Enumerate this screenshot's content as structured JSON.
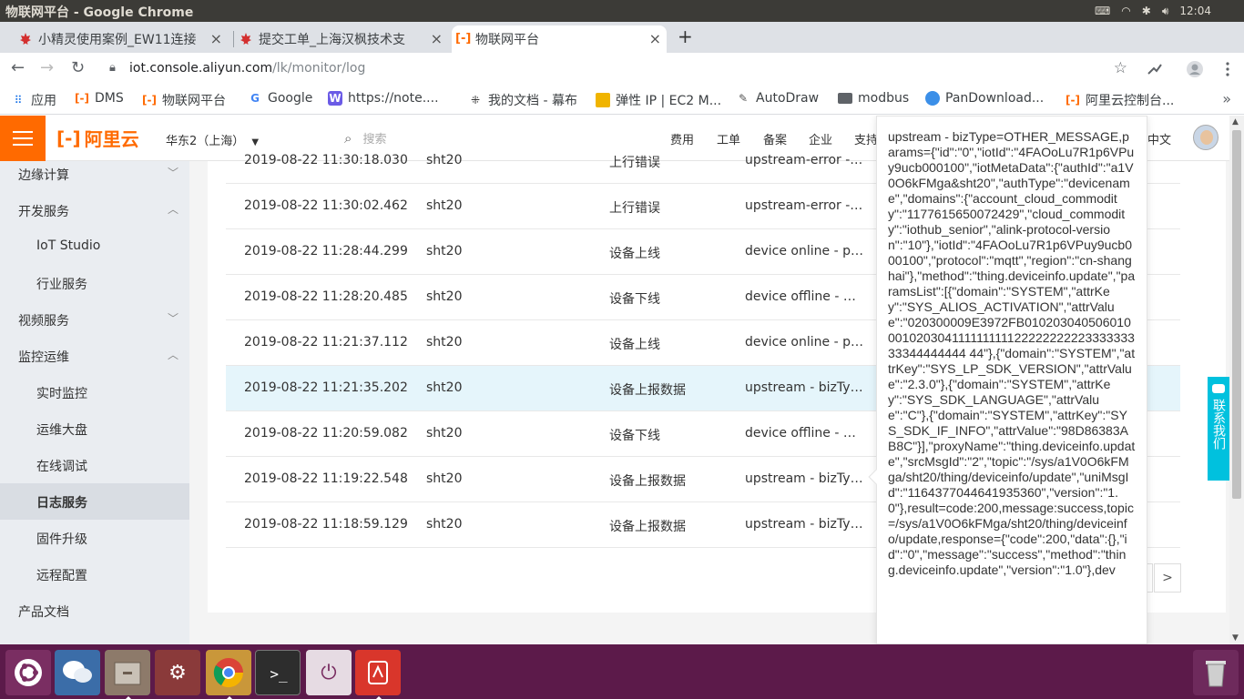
{
  "system": {
    "window_title": "物联网平台 - Google Chrome",
    "clock": "12:04"
  },
  "tabs": [
    {
      "label": "小精灵使用案例_EW11连接",
      "close": "×"
    },
    {
      "label": "提交工单_上海汉枫技术支",
      "close": "×"
    },
    {
      "label": "物联网平台",
      "close": "×"
    }
  ],
  "toolbar": {
    "new_tab": "+",
    "back": "←",
    "forward": "→",
    "reload": "↻",
    "url_host": "iot.console.aliyun.com",
    "url_path": "/lk/monitor/log",
    "star": "☆"
  },
  "bookmarks": [
    {
      "label": "应用",
      "icon": "apps-icon"
    },
    {
      "label": "DMS",
      "icon": "aliyun-icon"
    },
    {
      "label": "物联网平台",
      "icon": "aliyun-icon"
    },
    {
      "label": "Google",
      "icon": "google-icon"
    },
    {
      "label": "https://note....",
      "icon": "note-icon"
    },
    {
      "label": "我的文档 - 幕布",
      "icon": "mubu-icon"
    },
    {
      "label": "弹性 IP | EC2 M...",
      "icon": "aws-icon"
    },
    {
      "label": "AutoDraw",
      "icon": "autodraw-icon"
    },
    {
      "label": "modbus",
      "icon": "folder-icon"
    },
    {
      "label": "PanDownload...",
      "icon": "cloud-icon"
    },
    {
      "label": "阿里云控制台...",
      "icon": "aliyun-icon"
    }
  ],
  "header": {
    "logo": "阿里云",
    "region": "华东2（上海）",
    "search_placeholder": "搜索",
    "links": [
      "费用",
      "工单",
      "备案",
      "企业",
      "支持"
    ],
    "language": "中文"
  },
  "sidebar": {
    "items": [
      {
        "label": "边缘计算",
        "chevron": "down",
        "level": 1
      },
      {
        "label": "开发服务",
        "chevron": "up",
        "level": 1
      },
      {
        "label": "IoT Studio",
        "level": 2
      },
      {
        "label": "行业服务",
        "level": 2
      },
      {
        "label": "视频服务",
        "chevron": "down",
        "level": 1
      },
      {
        "label": "监控运维",
        "chevron": "up",
        "level": 1
      },
      {
        "label": "实时监控",
        "level": 2
      },
      {
        "label": "运维大盘",
        "level": 2
      },
      {
        "label": "在线调试",
        "level": 2
      },
      {
        "label": "日志服务",
        "level": 2,
        "active": true
      },
      {
        "label": "固件升级",
        "level": 2
      },
      {
        "label": "远程配置",
        "level": 2
      },
      {
        "label": "产品文档",
        "level": 1
      }
    ]
  },
  "logs": {
    "rows": [
      {
        "time": "2019-08-22 11:30:18.030",
        "device": "sht20",
        "type": "上行错误",
        "content": "upstream-error - ..."
      },
      {
        "time": "2019-08-22 11:30:02.462",
        "device": "sht20",
        "type": "上行错误",
        "content": "upstream-error - ..."
      },
      {
        "time": "2019-08-22 11:28:44.299",
        "device": "sht20",
        "type": "设备上线",
        "content": "device online - pa..."
      },
      {
        "time": "2019-08-22 11:28:20.485",
        "device": "sht20",
        "type": "设备下线",
        "content": "device offline - pa..."
      },
      {
        "time": "2019-08-22 11:21:37.112",
        "device": "sht20",
        "type": "设备上线",
        "content": "device online - pa..."
      },
      {
        "time": "2019-08-22 11:21:35.202",
        "device": "sht20",
        "type": "设备上报数据",
        "content": "upstream - bizTyp..."
      },
      {
        "time": "2019-08-22 11:20:59.082",
        "device": "sht20",
        "type": "设备下线",
        "content": "device offline - pa..."
      },
      {
        "time": "2019-08-22 11:19:22.548",
        "device": "sht20",
        "type": "设备上报数据",
        "content": "upstream - bizTyp..."
      },
      {
        "time": "2019-08-22 11:18:59.129",
        "device": "sht20",
        "type": "设备上报数据",
        "content": "upstream - bizTyp..."
      }
    ],
    "pagination": {
      "prev": "<",
      "next": ">"
    }
  },
  "popover": {
    "text": "upstream - bizType=OTHER_MESSAGE,params={\"id\":\"0\",\"iotId\":\"4FAOoLu7R1p6VPuy9ucb000100\",\"iotMetaData\":{\"authId\":\"a1V0O6kFMga&sht20\",\"authType\":\"devicename\",\"domains\":{\"account_cloud_commodity\":\"1177615650072429\",\"cloud_commodity\":\"iothub_senior\",\"alink-protocol-version\":\"10\"},\"iotId\":\"4FAOoLu7R1p6VPuy9ucb000100\",\"protocol\":\"mqtt\",\"region\":\"cn-shanghai\"},\"method\":\"thing.deviceinfo.update\",\"paramsList\":[{\"domain\":\"SYSTEM\",\"attrKey\":\"SYS_ALIOS_ACTIVATION\",\"attrValue\":\"020300009E3972FB01020304050601000102030411111111112222222222333333333344444444 44\"},{\"domain\":\"SYSTEM\",\"attrKey\":\"SYS_LP_SDK_VERSION\",\"attrValue\":\"2.3.0\"},{\"domain\":\"SYSTEM\",\"attrKey\":\"SYS_SDK_LANGUAGE\",\"attrValue\":\"C\"},{\"domain\":\"SYSTEM\",\"attrKey\":\"SYS_SDK_IF_INFO\",\"attrValue\":\"98D86383AB8C\"}],\"proxyName\":\"thing.deviceinfo.update\",\"srcMsgId\":\"2\",\"topic\":\"/sys/a1V0O6kFMga/sht20/thing/deviceinfo/update\",\"uniMsgId\":\"1164377044641935360\",\"version\":\"1.0\"},result=code:200,message:success,topic=/sys/a1V0O6kFMga/sht20/thing/deviceinfo/update,response={\"code\":200,\"data\":{},\"id\":\"0\",\"message\":\"success\",\"method\":\"thing.deviceinfo.update\",\"version\":\"1.0\"},dev"
  },
  "contact": {
    "label": "联系我们"
  },
  "colors": {
    "brand": "#ff6a00",
    "contact": "#00c1de",
    "highlight_row": "#e5f5fb",
    "launcher": "#5c1a4a"
  },
  "launcher": [
    {
      "name": "ubuntu-icon"
    },
    {
      "name": "wechat-icon"
    },
    {
      "name": "files-icon"
    },
    {
      "name": "settings-icon"
    },
    {
      "name": "chrome-icon"
    },
    {
      "name": "terminal-icon"
    },
    {
      "name": "power-icon"
    },
    {
      "name": "wps-icon"
    },
    {
      "name": "trash-icon"
    }
  ]
}
